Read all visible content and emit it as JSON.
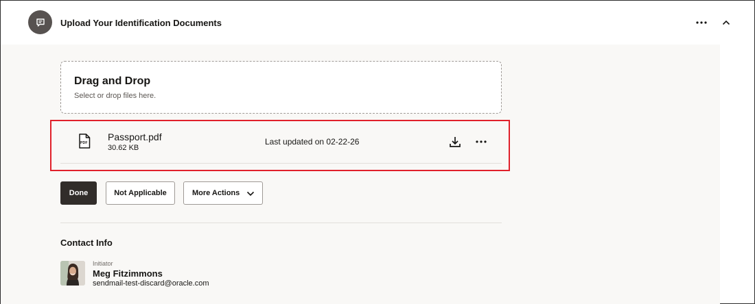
{
  "header": {
    "title": "Upload Your Identification Documents",
    "badge_icon": "comment-icon",
    "more_icon": "more-horizontal-icon",
    "collapse_icon": "chevron-up-icon"
  },
  "dropzone": {
    "title": "Drag and Drop",
    "subtitle": "Select or drop files here."
  },
  "files": [
    {
      "icon": "pdf-file-icon",
      "icon_label": "PDF",
      "name": "Passport.pdf",
      "size": "30.62 KB",
      "updated": "Last updated on 02-22-26",
      "actions": [
        "download-icon",
        "more-horizontal-icon"
      ]
    }
  ],
  "actions": {
    "done_label": "Done",
    "not_applicable_label": "Not Applicable",
    "more_actions_label": "More Actions"
  },
  "contact": {
    "title": "Contact Info",
    "role": "Initiator",
    "name": "Meg Fitzimmons",
    "email": "sendmail-test-discard@oracle.com"
  },
  "colors": {
    "badge": "#575250",
    "primary_button": "#312d2a",
    "panel_background": "#f9f8f6",
    "highlight": "#e0202a"
  }
}
